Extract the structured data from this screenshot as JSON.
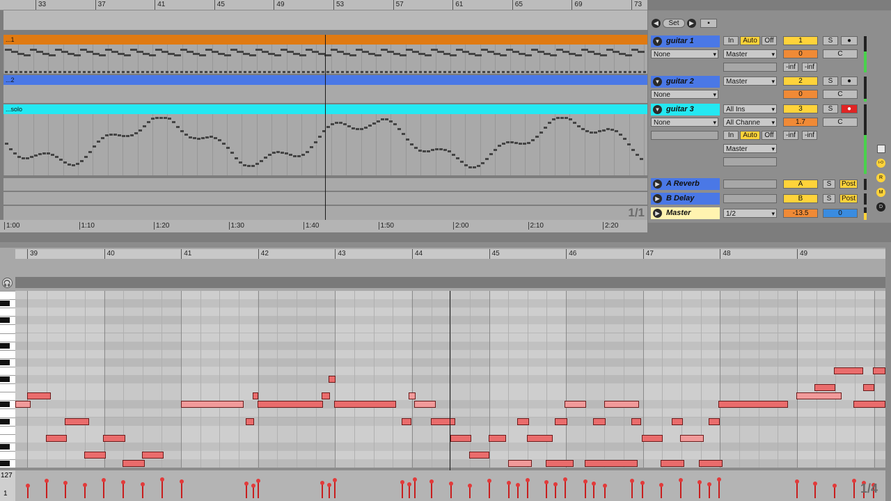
{
  "arrangement": {
    "bar_labels": [
      "33",
      "37",
      "41",
      "45",
      "49",
      "53",
      "57",
      "61",
      "65",
      "69",
      "73"
    ],
    "clips": [
      {
        "label": "...1",
        "color": "#e07a12"
      },
      {
        "label": "...2",
        "color": "#4a78e6"
      },
      {
        "label": "...solo",
        "color": "#24e8f2"
      }
    ],
    "page_indicator": "1/1",
    "time_labels": [
      "1:00",
      "1:10",
      "1:20",
      "1:30",
      "1:40",
      "1:50",
      "2:00",
      "2:10",
      "2:20"
    ]
  },
  "mixer": {
    "set_label": "Set",
    "tracks": [
      {
        "name": "guitar 1",
        "color": "#4a78e6",
        "input": "None",
        "output": "Master",
        "monitor": [
          "In",
          "Auto",
          "Off"
        ],
        "number": "1",
        "solo": "S",
        "volume": "0",
        "pan": "C",
        "sends": [
          "-inf",
          "-inf"
        ]
      },
      {
        "name": "guitar 2",
        "color": "#4a78e6",
        "output": "Master",
        "number": "2",
        "solo": "S",
        "volume": "0",
        "pan": "C"
      },
      {
        "name": "guitar 3",
        "color": "#24e8f2",
        "input_type": "All Ins",
        "input": "None",
        "channel": "All Channe",
        "monitor": [
          "In",
          "Auto",
          "Off"
        ],
        "output": "Master",
        "number": "3",
        "solo": "S",
        "volume": "1.7",
        "pan": "C",
        "sends": [
          "-inf",
          "-inf"
        ]
      }
    ],
    "returns": [
      {
        "name": "A Reverb",
        "letter": "A",
        "solo": "S",
        "post": "Post"
      },
      {
        "name": "B Delay",
        "letter": "B",
        "solo": "S",
        "post": "Post"
      }
    ],
    "master": {
      "name": "Master",
      "cue": "1/2",
      "volume": "-13.5",
      "pan": "0"
    },
    "side_buttons": [
      "I-O",
      "R",
      "M",
      "D"
    ]
  },
  "piano_roll": {
    "bar_labels": [
      "39",
      "40",
      "41",
      "42",
      "43",
      "44",
      "45",
      "46",
      "47",
      "48",
      "49"
    ],
    "velocity_max": "127",
    "velocity_min": "1",
    "page_indicator": "1/4"
  },
  "colors": {
    "accent_yellow": "#ffd33a",
    "note_red": "#ea6c6c",
    "meter_green": "#49d24c"
  }
}
